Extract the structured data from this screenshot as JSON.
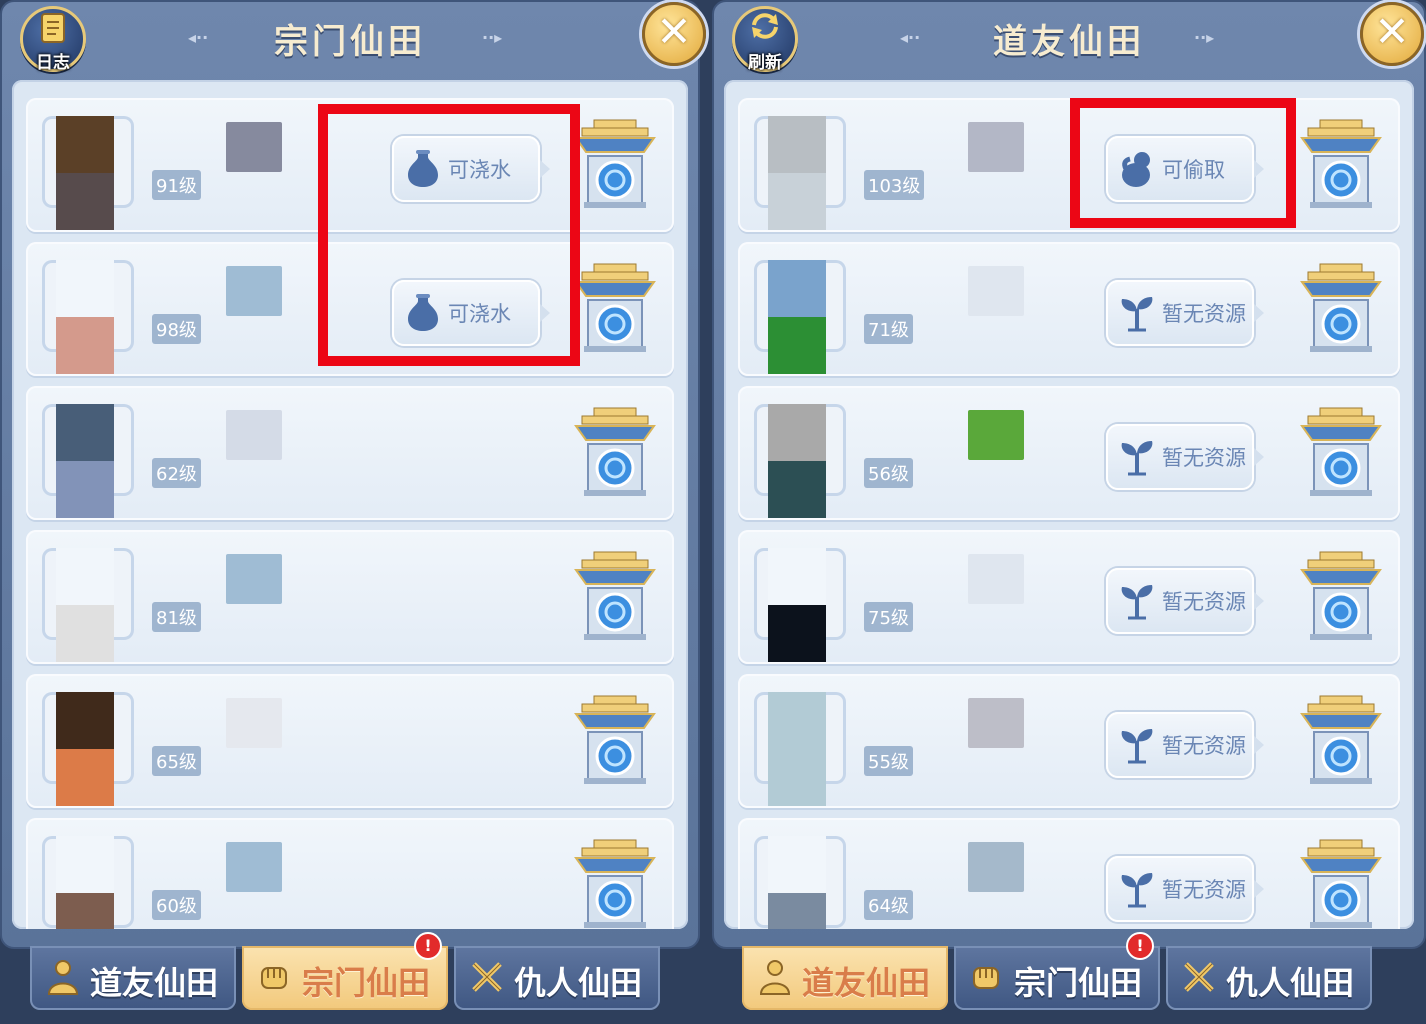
{
  "colors": {
    "highlight": "#ec0615",
    "panel": "#6f87ad",
    "row_bg": "#f1f6fb",
    "label": "#6a86b4"
  },
  "left_panel": {
    "title": "宗门仙田",
    "deco_left": "◂··",
    "deco_right": "··▸",
    "log_button": {
      "icon": "scroll-icon",
      "label": "日志"
    },
    "close_icon": "close-icon",
    "close_glyph": "✕",
    "rows": [
      {
        "level": "91级",
        "avatar_top": "#5b4027",
        "avatar_bottom": "#574b4c",
        "name_blur": "#868a9e",
        "action": "可浇水"
      },
      {
        "level": "98级",
        "avatar_top": "#f1f6fb",
        "avatar_bottom": "#d49a8c",
        "name_blur": "#9fbcd4",
        "action": "可浇水"
      },
      {
        "level": "62级",
        "avatar_top": "#485e78",
        "avatar_bottom": "#8293b8",
        "name_blur": "#d4dbe7",
        "action": ""
      },
      {
        "level": "81级",
        "avatar_top": "#f1f6fb",
        "avatar_bottom": "#e0e0e0",
        "name_blur": "#9fbcd4",
        "action": ""
      },
      {
        "level": "65级",
        "avatar_top": "#402a1b",
        "avatar_bottom": "#dc7b48",
        "name_blur": "#e5e8ee",
        "action": ""
      },
      {
        "level": "60级",
        "avatar_top": "#f1f6fb",
        "avatar_bottom": "#7d5d4f",
        "name_blur": "#9fbcd4",
        "action": ""
      }
    ]
  },
  "right_panel": {
    "title": "道友仙田",
    "deco_left": "◂··",
    "deco_right": "··▸",
    "refresh_button": {
      "icon": "refresh-icon",
      "label": "刷新"
    },
    "close_icon": "close-icon",
    "close_glyph": "✕",
    "rows": [
      {
        "level": "103级",
        "avatar_top": "#b8bec3",
        "avatar_bottom": "#c8d1d8",
        "name_blur": "#b3b7c6",
        "action": "可偷取",
        "action_icon": "hand-grab-icon"
      },
      {
        "level": "71级",
        "avatar_top": "#7aa3cc",
        "avatar_bottom": "#2c8f34",
        "name_blur": "#dfe6ef",
        "action": "暂无资源",
        "action_icon": "sprout-icon"
      },
      {
        "level": "56级",
        "avatar_top": "#a9a9a9",
        "avatar_bottom": "#2c4f54",
        "name_blur": "#5aa83a",
        "action": "暂无资源",
        "action_icon": "sprout-icon"
      },
      {
        "level": "75级",
        "avatar_top": "#f1f6fb",
        "avatar_bottom": "#0c121c",
        "name_blur": "#dfe6ef",
        "action": "暂无资源",
        "action_icon": "sprout-icon"
      },
      {
        "level": "55级",
        "avatar_top": "#b2cbd5",
        "avatar_bottom": "#b2cbd5",
        "name_blur": "#bdbec8",
        "action": "暂无资源",
        "action_icon": "sprout-icon"
      },
      {
        "level": "64级",
        "avatar_top": "#f1f6fb",
        "avatar_bottom": "#7a8ba0",
        "name_blur": "#a5b9cb",
        "action": "暂无资源",
        "action_icon": "sprout-icon"
      }
    ]
  },
  "left_tabs": [
    {
      "label": "道友仙田",
      "icon": "person-icon",
      "active": false
    },
    {
      "label": "宗门仙田",
      "icon": "fist-icon",
      "active": true,
      "badge": "!"
    },
    {
      "label": "仇人仙田",
      "icon": "crossed-swords-icon",
      "active": false
    }
  ],
  "right_tabs": [
    {
      "label": "道友仙田",
      "icon": "person-icon",
      "active": true
    },
    {
      "label": "宗门仙田",
      "icon": "fist-icon",
      "active": false,
      "badge": "!"
    },
    {
      "label": "仇人仙田",
      "icon": "crossed-swords-icon",
      "active": false
    }
  ]
}
